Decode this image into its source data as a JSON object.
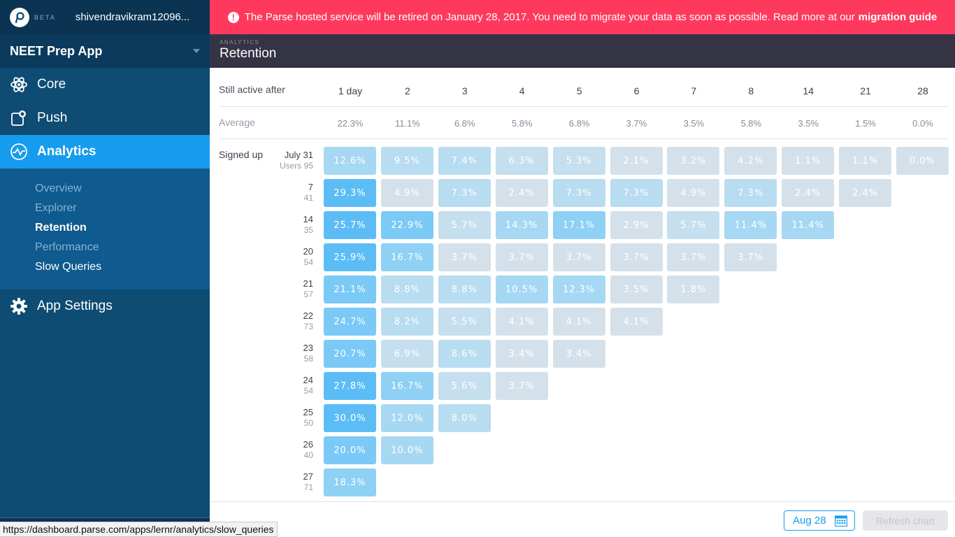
{
  "sidebar": {
    "beta": "BETA",
    "username": "shivendravikram12096...",
    "app_name": "NEET Prep App",
    "nav": {
      "core": "Core",
      "push": "Push",
      "analytics": "Analytics",
      "app_settings": "App Settings"
    },
    "subnav": [
      "Overview",
      "Explorer",
      "Retention",
      "Performance",
      "Slow Queries"
    ]
  },
  "banner": {
    "icon": "!",
    "message": "The Parse hosted service will be retired on January 28, 2017. You need to migrate your data as soon as possible. Read more at our",
    "link": "migration guide"
  },
  "header": {
    "section": "ANALYTICS",
    "title": "Retention"
  },
  "table": {
    "still_active_label": "Still active after",
    "average_label": "Average",
    "signed_up_label": "Signed up",
    "users_label": "Users",
    "columns": [
      "1 day",
      "2",
      "3",
      "4",
      "5",
      "6",
      "7",
      "8",
      "14",
      "21",
      "28"
    ],
    "averages": [
      "22.3%",
      "11.1%",
      "6.8%",
      "5.8%",
      "6.8%",
      "3.7%",
      "3.5%",
      "5.8%",
      "3.5%",
      "1.5%",
      "0.0%"
    ],
    "rows": [
      {
        "date": "July 31",
        "users": "95",
        "values": [
          "12.6%",
          "9.5%",
          "7.4%",
          "6.3%",
          "5.3%",
          "2.1%",
          "3.2%",
          "4.2%",
          "1.1%",
          "1.1%",
          "0.0%"
        ]
      },
      {
        "date": "7",
        "users": "41",
        "values": [
          "29.3%",
          "4.9%",
          "7.3%",
          "2.4%",
          "7.3%",
          "7.3%",
          "4.9%",
          "7.3%",
          "2.4%",
          "2.4%"
        ]
      },
      {
        "date": "14",
        "users": "35",
        "values": [
          "25.7%",
          "22.9%",
          "5.7%",
          "14.3%",
          "17.1%",
          "2.9%",
          "5.7%",
          "11.4%",
          "11.4%"
        ]
      },
      {
        "date": "20",
        "users": "54",
        "values": [
          "25.9%",
          "16.7%",
          "3.7%",
          "3.7%",
          "3.7%",
          "3.7%",
          "3.7%",
          "3.7%"
        ]
      },
      {
        "date": "21",
        "users": "57",
        "values": [
          "21.1%",
          "8.8%",
          "8.8%",
          "10.5%",
          "12.3%",
          "3.5%",
          "1.8%"
        ]
      },
      {
        "date": "22",
        "users": "73",
        "values": [
          "24.7%",
          "8.2%",
          "5.5%",
          "4.1%",
          "4.1%",
          "4.1%"
        ]
      },
      {
        "date": "23",
        "users": "58",
        "values": [
          "20.7%",
          "6.9%",
          "8.6%",
          "3.4%",
          "3.4%"
        ]
      },
      {
        "date": "24",
        "users": "54",
        "values": [
          "27.8%",
          "16.7%",
          "5.6%",
          "3.7%"
        ]
      },
      {
        "date": "25",
        "users": "50",
        "values": [
          "30.0%",
          "12.0%",
          "8.0%"
        ]
      },
      {
        "date": "26",
        "users": "40",
        "values": [
          "20.0%",
          "10.0%"
        ]
      },
      {
        "date": "27",
        "users": "71",
        "values": [
          "18.3%"
        ]
      }
    ]
  },
  "footer": {
    "date": "Aug 28",
    "refresh": "Refresh chart"
  },
  "status_url": "https://dashboard.parse.com/apps/lernr/analytics/slow_queries",
  "colors": {
    "brand_blue": "#169cee",
    "banner_red": "#ff395e",
    "header_dark": "#353445",
    "sidebar": "#0e4c73"
  }
}
